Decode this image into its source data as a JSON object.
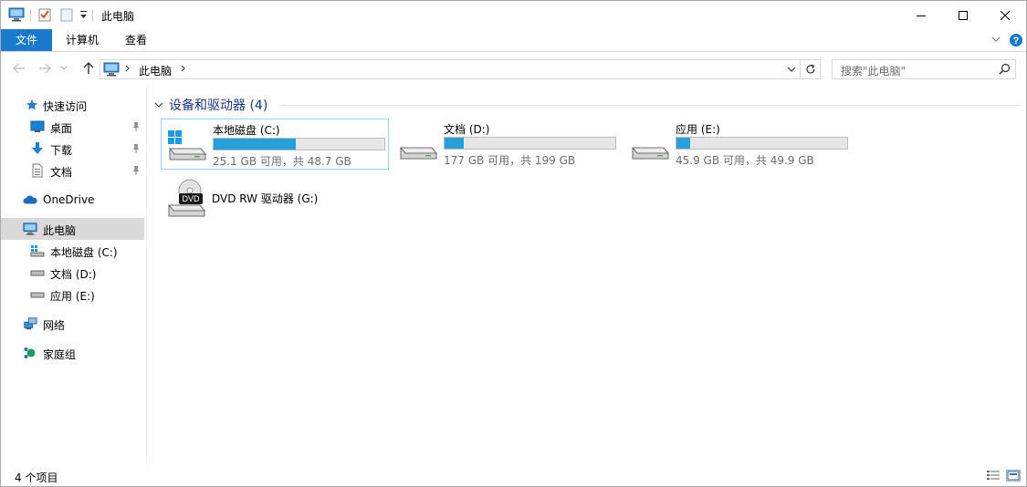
{
  "window": {
    "title": "此电脑",
    "controls": [
      "minimize-icon",
      "maximize-icon",
      "close-icon"
    ]
  },
  "ribbon": {
    "tabs": [
      {
        "label": "文件",
        "active": true
      },
      {
        "label": "计算机",
        "active": false
      },
      {
        "label": "查看",
        "active": false
      }
    ]
  },
  "address": {
    "crumbs": [
      "此电脑"
    ],
    "search_placeholder": "搜索\"此电脑\""
  },
  "sidebar": {
    "quick_access": {
      "label": "快速访问"
    },
    "pinned": [
      {
        "label": "桌面"
      },
      {
        "label": "下载"
      },
      {
        "label": "文档"
      }
    ],
    "onedrive": {
      "label": "OneDrive"
    },
    "this_pc": {
      "label": "此电脑"
    },
    "pc_drives": [
      {
        "label": "本地磁盘 (C:)"
      },
      {
        "label": "文档 (D:)"
      },
      {
        "label": "应用 (E:)"
      }
    ],
    "network": {
      "label": "网络"
    },
    "homegroup": {
      "label": "家庭组"
    }
  },
  "content": {
    "group_title": "设备和驱动器 (4)",
    "drives": [
      {
        "name": "本地磁盘 (C:)",
        "size_text": "25.1 GB 可用，共 48.7 GB",
        "used_fraction": 0.48,
        "type": "system-drive",
        "selected": true
      },
      {
        "name": "文档 (D:)",
        "size_text": "177 GB 可用，共 199 GB",
        "used_fraction": 0.11,
        "type": "hard-drive",
        "selected": false
      },
      {
        "name": "应用 (E:)",
        "size_text": "45.9 GB 可用，共 49.9 GB",
        "used_fraction": 0.08,
        "type": "hard-drive",
        "selected": false
      }
    ],
    "dvd": {
      "name": "DVD RW 驱动器 (G:)",
      "badge": "DVD"
    }
  },
  "status": {
    "count_text": "4 个项目"
  },
  "colors": {
    "accent": "#1979ca",
    "progress": "#26a0da",
    "selection": "#d9d9d9",
    "group_title": "#1e3287"
  }
}
